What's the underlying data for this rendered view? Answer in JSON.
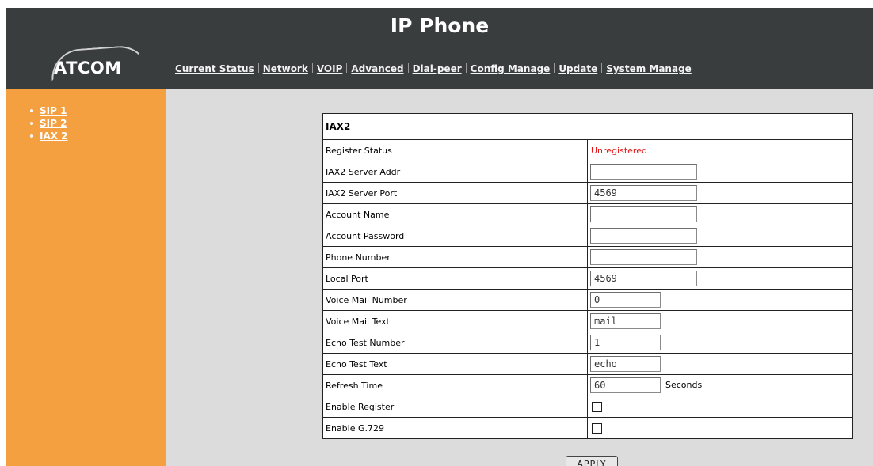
{
  "header": {
    "title": "IP Phone",
    "logo_text": "ATCOM"
  },
  "nav": {
    "items": [
      {
        "label": "Current Status"
      },
      {
        "label": "Network"
      },
      {
        "label": "VOIP"
      },
      {
        "label": "Advanced"
      },
      {
        "label": "Dial-peer"
      },
      {
        "label": "Config Manage"
      },
      {
        "label": "Update"
      },
      {
        "label": "System Manage"
      }
    ]
  },
  "sidebar": {
    "items": [
      {
        "label": "SIP 1"
      },
      {
        "label": "SIP 2"
      },
      {
        "label": "IAX 2"
      }
    ]
  },
  "form": {
    "title": "IAX2",
    "register_status": {
      "label": "Register Status",
      "value": "Unregistered",
      "color": "#e21616"
    },
    "server_addr": {
      "label": "IAX2 Server Addr",
      "value": ""
    },
    "server_port": {
      "label": "IAX2 Server Port",
      "value": "4569"
    },
    "account_name": {
      "label": "Account Name",
      "value": ""
    },
    "account_password": {
      "label": "Account Password",
      "value": ""
    },
    "phone_number": {
      "label": "Phone Number",
      "value": ""
    },
    "local_port": {
      "label": "Local Port",
      "value": "4569"
    },
    "voice_mail_number": {
      "label": "Voice Mail Number",
      "value": "0"
    },
    "voice_mail_text": {
      "label": "Voice Mail Text",
      "value": "mail"
    },
    "echo_test_number": {
      "label": "Echo Test Number",
      "value": "1"
    },
    "echo_test_text": {
      "label": "Echo Test Text",
      "value": "echo"
    },
    "refresh_time": {
      "label": "Refresh Time",
      "value": "60",
      "unit": "Seconds"
    },
    "enable_register": {
      "label": "Enable Register",
      "checked": false
    },
    "enable_g729": {
      "label": "Enable G.729",
      "checked": false
    }
  },
  "apply_label": "APPLY",
  "colors": {
    "header_bg": "#3a3d3d",
    "sidebar_bg": "#f4a040",
    "content_bg": "#dcdcdc"
  }
}
